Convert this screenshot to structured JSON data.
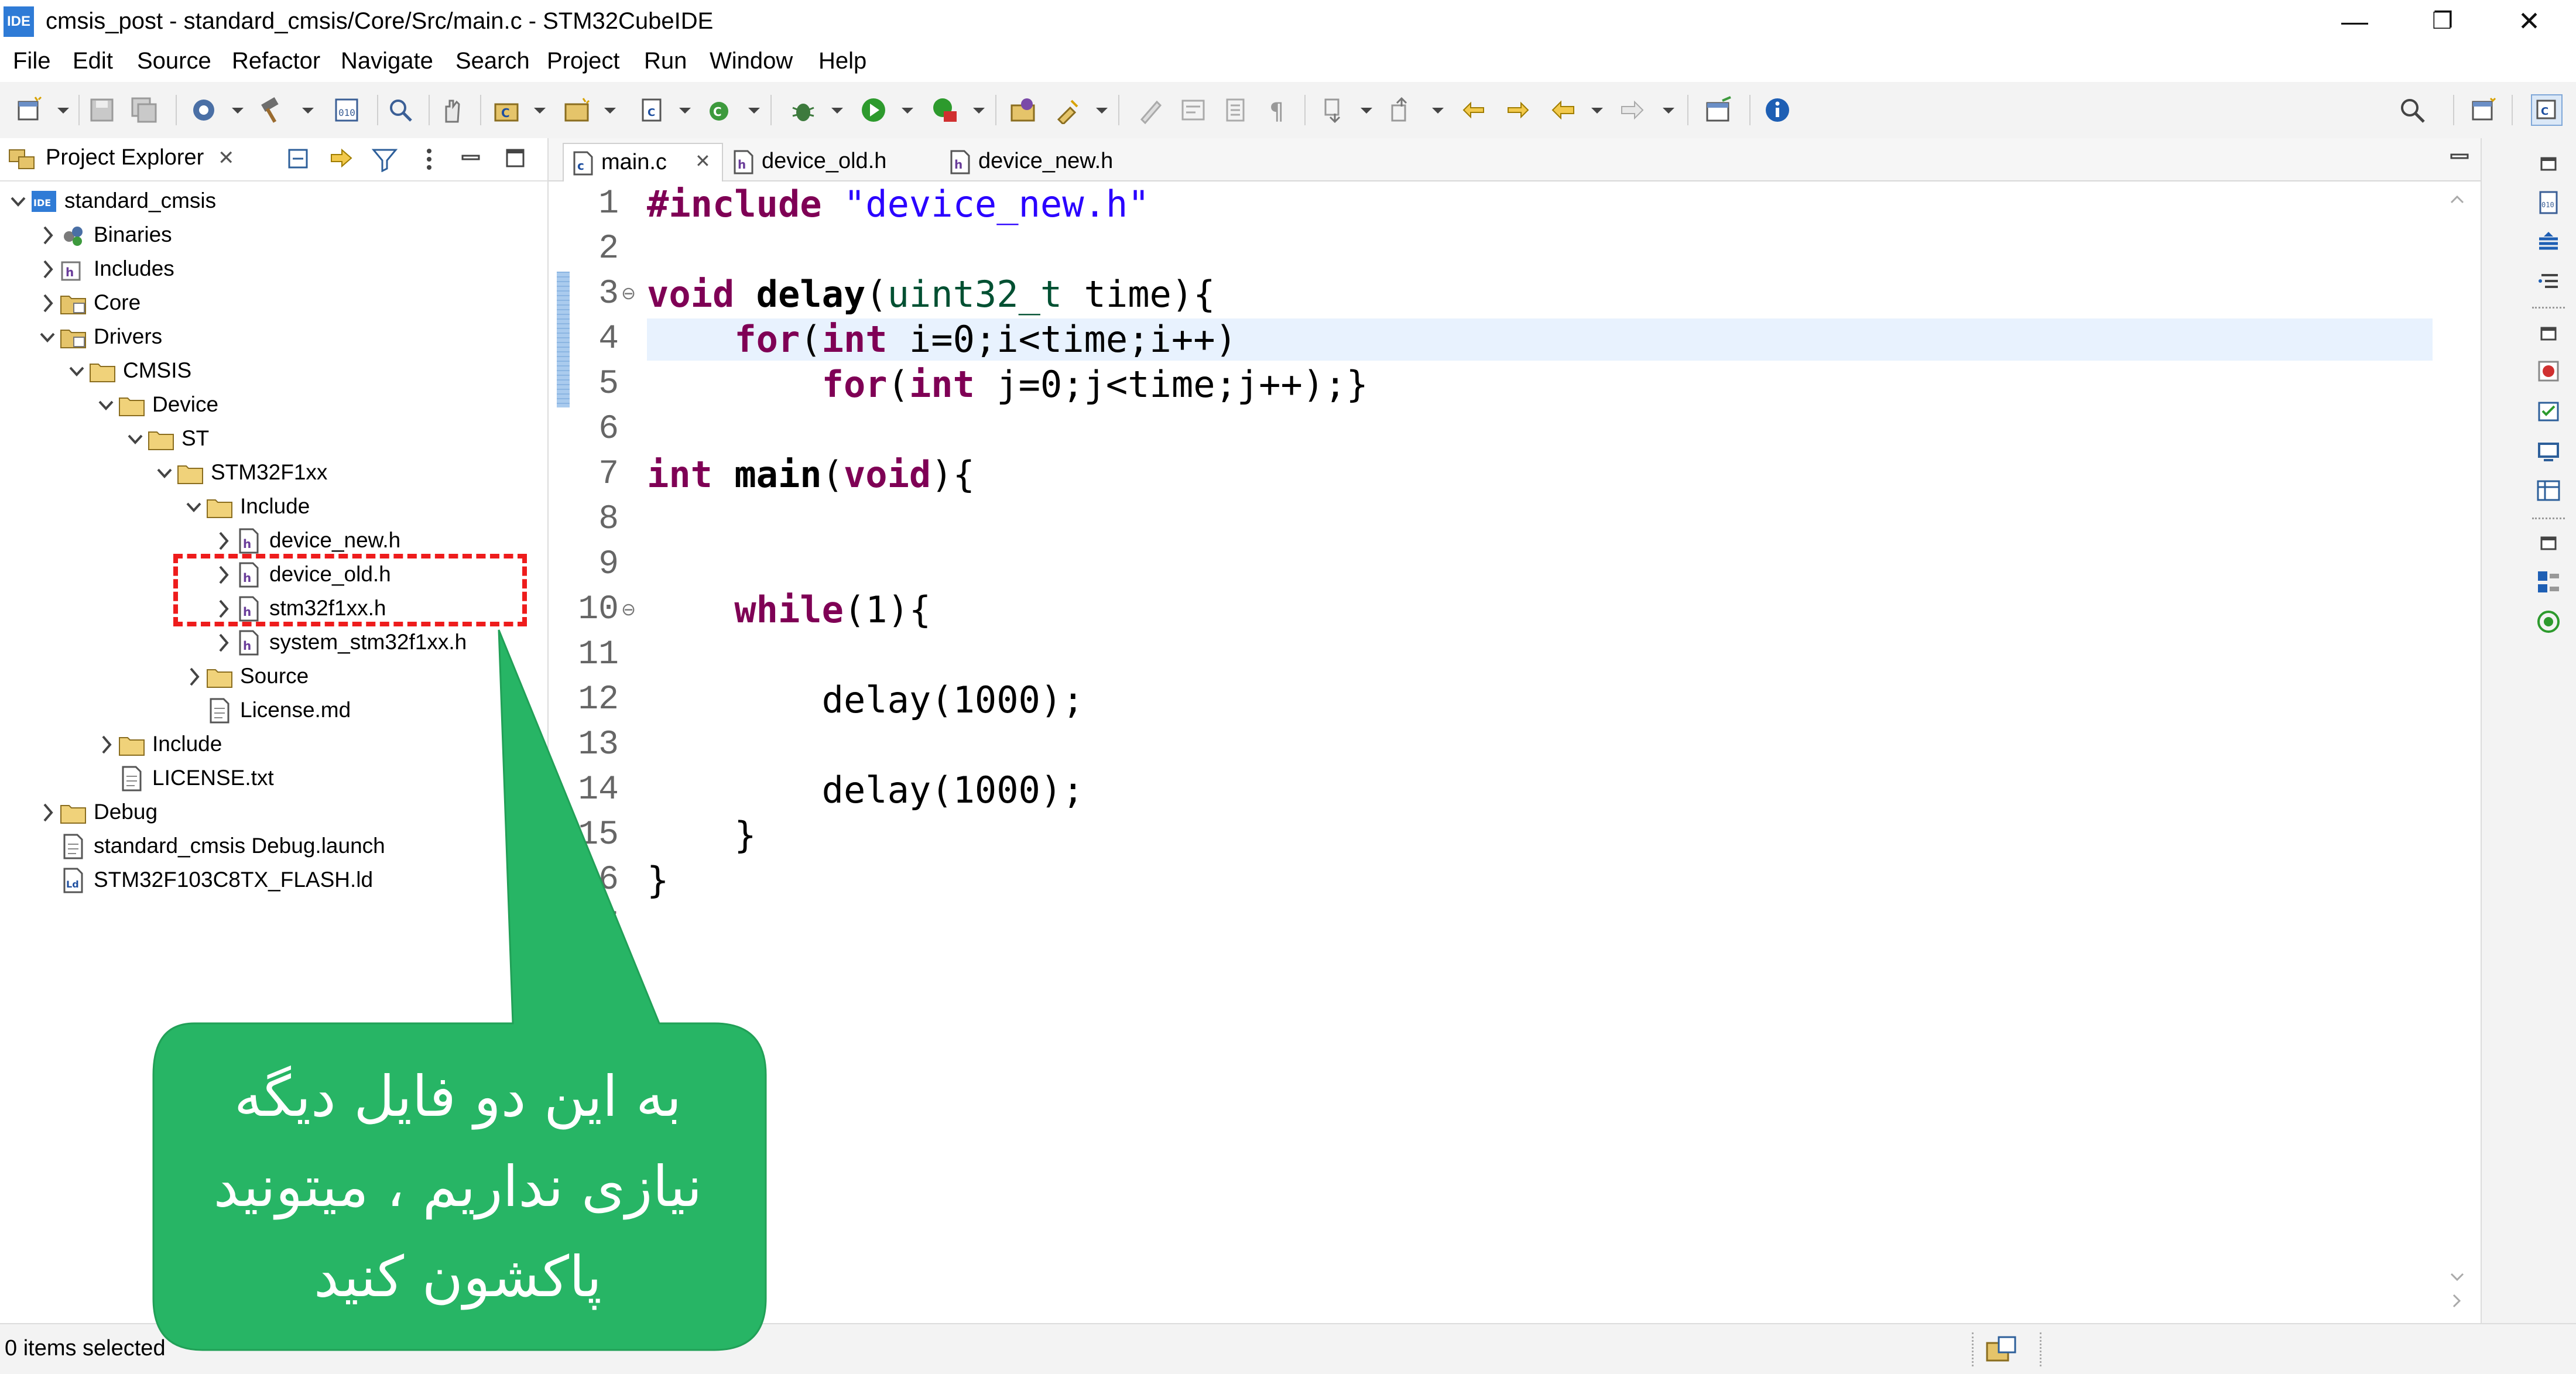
{
  "window": {
    "title": "cmsis_post - standard_cmsis/Core/Src/main.c - STM32CubeIDE",
    "logo_text": "IDE",
    "minimize": "—",
    "maximize": "❐",
    "close": "✕"
  },
  "menu": [
    "File",
    "Edit",
    "Source",
    "Refactor",
    "Navigate",
    "Search",
    "Project",
    "Run",
    "Window",
    "Help"
  ],
  "explorer": {
    "tab_label": "Project Explorer",
    "tab_close": "✕",
    "tree": [
      {
        "label": "standard_cmsis",
        "icon": "ide-project-icon",
        "chevron": "down"
      },
      {
        "label": "Binaries",
        "icon": "binaries-icon",
        "chevron": "right"
      },
      {
        "label": "Includes",
        "icon": "includes-icon",
        "chevron": "right"
      },
      {
        "label": "Core",
        "icon": "source-folder-icon",
        "chevron": "right"
      },
      {
        "label": "Drivers",
        "icon": "source-folder-icon",
        "chevron": "down"
      },
      {
        "label": "CMSIS",
        "icon": "folder-icon",
        "chevron": "down"
      },
      {
        "label": "Device",
        "icon": "folder-icon",
        "chevron": "down"
      },
      {
        "label": "ST",
        "icon": "folder-icon",
        "chevron": "down"
      },
      {
        "label": "STM32F1xx",
        "icon": "folder-icon",
        "chevron": "down"
      },
      {
        "label": "Include",
        "icon": "folder-icon",
        "chevron": "down"
      },
      {
        "label": "device_new.h",
        "icon": "header-file-icon",
        "chevron": "right"
      },
      {
        "label": "device_old.h",
        "icon": "header-file-icon",
        "chevron": "right"
      },
      {
        "label": "stm32f1xx.h",
        "icon": "header-file-icon",
        "chevron": "right"
      },
      {
        "label": "system_stm32f1xx.h",
        "icon": "header-file-icon",
        "chevron": "right"
      },
      {
        "label": "Source",
        "icon": "folder-icon",
        "chevron": "right"
      },
      {
        "label": "License.md",
        "icon": "text-file-icon",
        "chevron": "none"
      },
      {
        "label": "Include",
        "icon": "folder-icon",
        "chevron": "right"
      },
      {
        "label": "LICENSE.txt",
        "icon": "text-file-icon",
        "chevron": "none"
      },
      {
        "label": "Debug",
        "icon": "folder-icon",
        "chevron": "right"
      },
      {
        "label": "standard_cmsis Debug.launch",
        "icon": "text-file-icon",
        "chevron": "none"
      },
      {
        "label": "STM32F103C8TX_FLASH.ld",
        "icon": "linker-file-icon",
        "chevron": "none"
      }
    ]
  },
  "editor": {
    "tabs": [
      {
        "label": "main.c",
        "close": "✕",
        "active": true,
        "icon": "c-file-icon"
      },
      {
        "label": "device_old.h",
        "active": false,
        "icon": "header-file-icon"
      },
      {
        "label": "device_new.h",
        "active": false,
        "icon": "header-file-icon"
      }
    ],
    "line_numbers": [
      "1",
      "2",
      "3",
      "4",
      "5",
      "6",
      "7",
      "8",
      "9",
      "10",
      "11",
      "12",
      "13",
      "14",
      "15",
      "16",
      "17"
    ],
    "fold_marker": "⊖",
    "tokens": {
      "l1_kw": "#include",
      "l1_str": "\"device_new.h\"",
      "l3_kw": "void",
      "l3_fn": "delay",
      "l3_p1": "(",
      "l3_typ": "uint32_t",
      "l3_rest": " time){",
      "l4_ind": "    ",
      "l4_kw1": "for",
      "l4_p1": "(",
      "l4_kw2": "int",
      "l4_rest": " i=0;i<time;i++)",
      "l5_ind": "        ",
      "l5_kw1": "for",
      "l5_p1": "(",
      "l5_kw2": "int",
      "l5_rest": " j=0;j<time;j++);}",
      "l7_kw": "int",
      "l7_fn": "main",
      "l7_p1": "(",
      "l7_kw2": "void",
      "l7_rest": "){",
      "l10_ind": "    ",
      "l10_kw": "while",
      "l10_rest": "(1){",
      "l12": "        delay(1000);",
      "l14": "        delay(1000);",
      "l15": "    }",
      "l16": "}"
    }
  },
  "status": {
    "text": "0 items selected"
  },
  "annotation": {
    "lines": [
      "به این دو فایل دیگه",
      "نیازی نداریم ، میتونید",
      "پاکشون کنید"
    ],
    "highlight_color": "#ee1c1c",
    "callout_color": "#27b565"
  }
}
